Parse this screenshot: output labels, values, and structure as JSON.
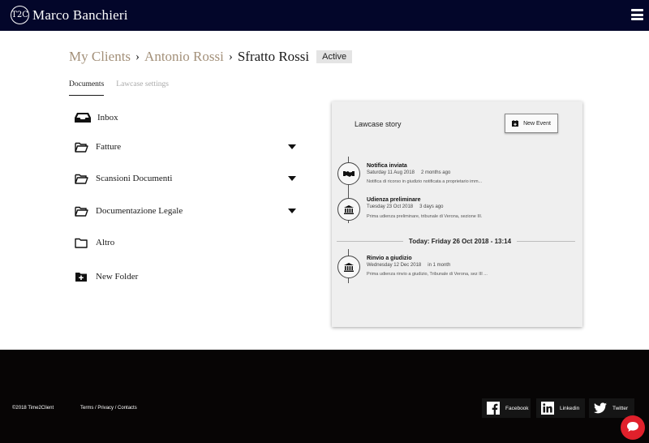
{
  "header": {
    "logo_text": "T2C",
    "brand_name": "Marco Banchieri"
  },
  "breadcrumb": {
    "items": [
      "My Clients",
      "Antonio Rossi"
    ],
    "separator": "›",
    "current": "Sfratto Rossi",
    "status": "Active"
  },
  "tabs": [
    {
      "label": "Documents",
      "active": true
    },
    {
      "label": "Lawcase settings",
      "active": false
    }
  ],
  "folders": [
    {
      "label": "Inbox",
      "icon": "inbox-icon"
    },
    {
      "label": "Fatture",
      "icon": "folder-open-icon",
      "expandable": true
    },
    {
      "label": "Scansioni Documenti",
      "icon": "folder-open-icon",
      "expandable": true
    },
    {
      "label": "Documentazione Legale",
      "icon": "folder-open-icon",
      "expandable": true
    },
    {
      "label": "Altro",
      "icon": "folder-icon"
    },
    {
      "label": "New Folder",
      "icon": "folder-plus-icon"
    }
  ],
  "story": {
    "title": "Lawcase story",
    "new_event_label": "New Event",
    "events": [
      {
        "icon": "handshake-icon",
        "title": "Notifica inviata",
        "date": "Saturday 11 Aug 2018",
        "relative": "2 months ago",
        "description": "Notifica di ricorso in giudizio notificata a proprietario imm..."
      },
      {
        "icon": "courthouse-icon",
        "title": "Udienza preliminare",
        "date": "Tuesday 23 Oct 2018",
        "relative": "3 days ago",
        "description": "Prima udienza preliminare, tribunale di Verona, sezione III."
      },
      {
        "icon": "courthouse-icon",
        "title": "Rinvio a giudizio",
        "date": "Wednesday 12 Dec 2018",
        "relative": "in 1 month",
        "description": "Prima udienza rinvio a giudizio, Tribunale di Verona, sez III ..."
      }
    ],
    "today_label": "Today: Friday 26 Oct 2018 - 13:14"
  },
  "footer": {
    "copyright": "©2018 Time2Client",
    "links": [
      "Terms",
      "Privacy",
      "Contacts"
    ],
    "link_separator": " / ",
    "social": [
      {
        "label": "Facebook",
        "icon": "facebook-icon"
      },
      {
        "label": "Linkedin",
        "icon": "linkedin-icon"
      },
      {
        "label": "Twitter",
        "icon": "twitter-icon"
      }
    ]
  },
  "colors": {
    "topbar": "#03062a",
    "breadcrumb_link": "#a39079",
    "footer": "#070505",
    "chat_button": "#e0202b"
  }
}
